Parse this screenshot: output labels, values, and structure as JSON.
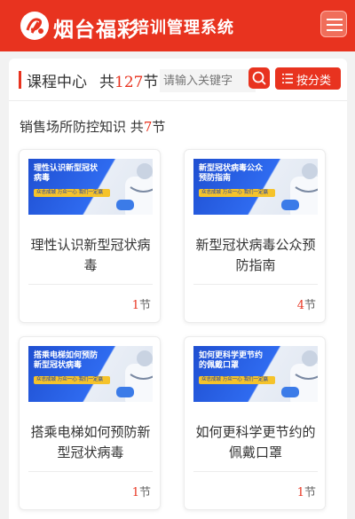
{
  "header": {
    "brand": "烟台福彩",
    "system_title": "培训管理系统"
  },
  "course_center": {
    "title": "课程中心",
    "total_prefix": "共",
    "total_count": "127",
    "total_suffix": "节",
    "search_placeholder": "请输入关键字",
    "category_label": "按分类"
  },
  "section": {
    "name": "销售场所防控知识",
    "total_prefix": "共",
    "total_count": "7",
    "total_suffix": "节"
  },
  "courses": [
    {
      "thumb_title": "理性认识新型冠状病毒",
      "thumb_slogan": "众志成城 万众一心 我们一定赢",
      "name": "理性认识新型冠状病毒",
      "count": "1",
      "count_suffix": "节"
    },
    {
      "thumb_title": "新型冠状病毒公众预防指南",
      "thumb_slogan": "众志成城 万众一心 我们一定赢",
      "name": "新型冠状病毒公众预防指南",
      "count": "4",
      "count_suffix": "节"
    },
    {
      "thumb_title": "搭乘电梯如何预防新型冠状病毒",
      "thumb_slogan": "众志成城 万众一心 我们一定赢",
      "name": "搭乘电梯如何预防新型冠状病毒",
      "count": "1",
      "count_suffix": "节"
    },
    {
      "thumb_title": "如何更科学更节约的佩戴口罩",
      "thumb_slogan": "众志成城 万众一心 我们一定赢",
      "name": "如何更科学更节约的佩戴口罩",
      "count": "1",
      "count_suffix": "节"
    }
  ],
  "icons": {
    "logo": "lottery-logo-icon",
    "menu": "hamburger-menu-icon",
    "search": "search-icon",
    "category": "list-icon"
  },
  "colors": {
    "brand_red": "#e8331f",
    "thumb_blue": "#2f6bf0",
    "slogan_yellow": "#f5c32b"
  }
}
